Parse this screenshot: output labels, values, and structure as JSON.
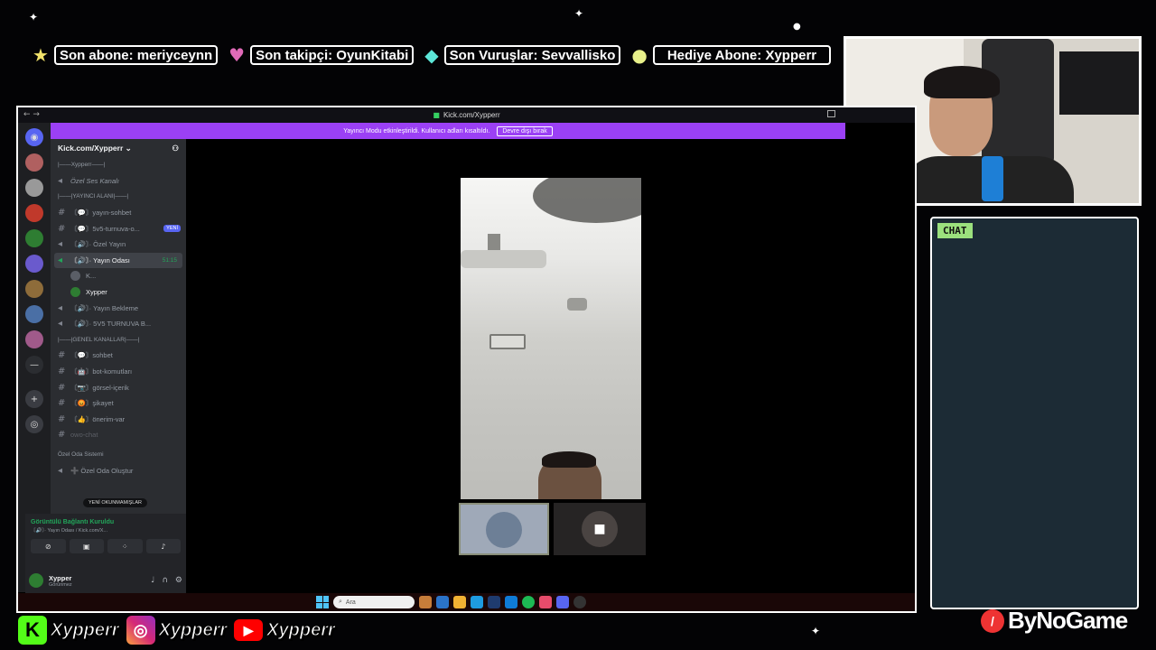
{
  "ticker": {
    "last_sub": "Son abone: meriyceynn",
    "last_follow": "Son takipçi: OyunKitabi",
    "last_hits": "Son Vuruşlar: Sevvallisko",
    "gift_sub": "Hediye Abone: Xypperr"
  },
  "chat": {
    "label": "CHAT"
  },
  "browser": {
    "url": "Kick.com/Xypperr",
    "banner_text": "Yayıncı Modu etkinleştirildi. Kullanıcı adları kısaltıldı.",
    "banner_button": "Devre dışı bırak"
  },
  "discord": {
    "server_name": "Kick.com/Xypperr",
    "channels": [
      {
        "type": "category",
        "label": "|——Xypperr——|"
      },
      {
        "type": "voice-italic",
        "label": "Özel Ses Kanalı"
      },
      {
        "type": "category",
        "label": "|——|YAYINCI ALANI|——|"
      },
      {
        "type": "text",
        "label": "〘💬〙yayın-sohbet"
      },
      {
        "type": "text",
        "label": "〘💬〙5v5-turnuva-o...",
        "badge": "YENİ"
      },
      {
        "type": "voice",
        "label": "〘🔊〙· Özel Yayın"
      },
      {
        "type": "voice-active",
        "label": "〘🔊〙· Yayın Odası",
        "timer": "51:15"
      },
      {
        "type": "user",
        "label": "K..."
      },
      {
        "type": "user",
        "label": "Xypper"
      },
      {
        "type": "voice",
        "label": "〘🔊〙· Yayın Bekleme"
      },
      {
        "type": "voice",
        "label": "〘🔊〙· 5V5 TURNUVA B..."
      },
      {
        "type": "category",
        "label": "|——|GENEL KANALLAR|——|"
      },
      {
        "type": "text",
        "label": "〘💬〙sohbet"
      },
      {
        "type": "text",
        "label": "〘🤖〙bot-komutları"
      },
      {
        "type": "text",
        "label": "〘📷〙görsel-içerik"
      },
      {
        "type": "text",
        "label": "〘😡〙şikayet"
      },
      {
        "type": "text",
        "label": "〘👍〙önerim-var"
      },
      {
        "type": "text-muted",
        "label": "owo-chat"
      },
      {
        "type": "category",
        "label": "Özel Oda Sistemi"
      },
      {
        "type": "voice",
        "label": "➕ Özel Oda Oluştur"
      }
    ],
    "unread_pill": "YENİ OKUNMAMIŞLAR",
    "voice_status": "Görüntülü Bağlantı Kuruldu",
    "voice_sub": "〘🔊〙· Yayın Odası / Kick.com/X...",
    "user_name": "Xypper",
    "user_status": "Görünmez"
  },
  "taskbar": {
    "search_placeholder": "Ara"
  },
  "socials": {
    "kick": "Xypperr",
    "instagram": "Xypperr",
    "youtube": "Xypperr"
  },
  "brand": "ByNoGame",
  "colors": {
    "discord_green": "#23a55a",
    "banner_purple": "#9b40f5",
    "kick_green": "#53fc18",
    "chat_bg": "#1c2b35",
    "chat_label_bg": "#9be07d"
  }
}
